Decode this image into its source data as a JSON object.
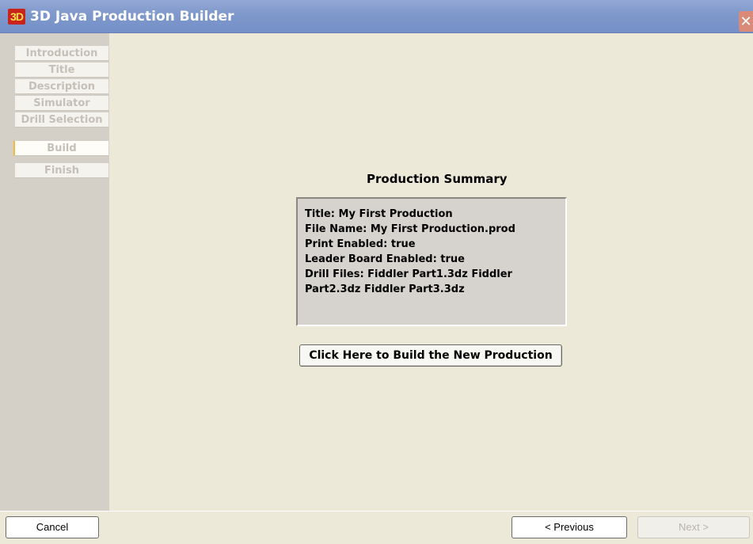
{
  "window": {
    "logo_text": "3D",
    "title": "3D Java Production Builder",
    "close_glyph": "✕"
  },
  "sidebar": {
    "steps": [
      {
        "label": "Introduction"
      },
      {
        "label": "Title"
      },
      {
        "label": "Description"
      },
      {
        "label": "Simulator"
      },
      {
        "label": "Drill Selection"
      },
      {
        "label": "Build"
      },
      {
        "label": "Finish"
      }
    ],
    "active_step": "Build"
  },
  "summary": {
    "heading": "Production Summary",
    "lines": [
      "Title:  My First Production",
      "File Name:  My First Production.prod",
      "Print Enabled:  true",
      "Leader Board Enabled:  true",
      "Drill Files:  Fiddler Part1.3dz  Fiddler",
      "Part2.3dz  Fiddler Part3.3dz"
    ]
  },
  "build_button_label": "Click Here to Build the New Production",
  "footer": {
    "cancel_label": "Cancel",
    "previous_label": "< Previous",
    "next_label": "Next >"
  },
  "colors": {
    "titlebar": "#7f98cb",
    "panel": "#ece9d8",
    "active_step_marker": "#f5b93a"
  }
}
